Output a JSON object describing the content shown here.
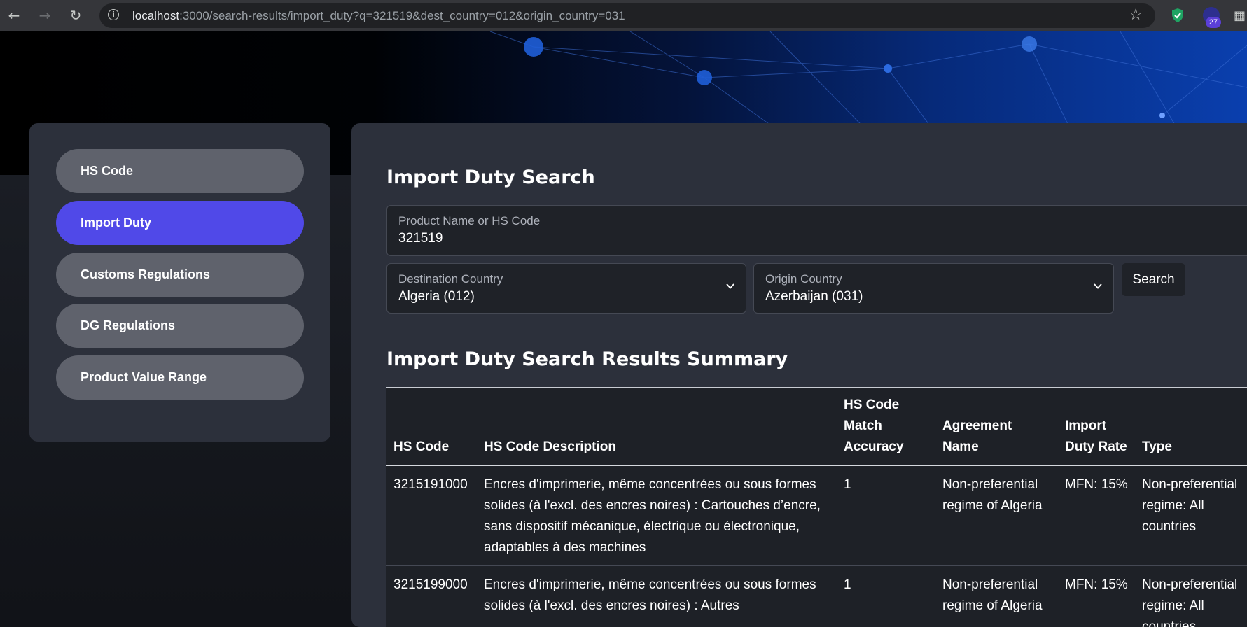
{
  "browser": {
    "url_host": "localhost",
    "url_rest": ":3000/search-results/import_duty?q=321519&dest_country=012&origin_country=031",
    "extension_badge": "27"
  },
  "sidebar": {
    "items": [
      {
        "label": "HS Code",
        "active": false
      },
      {
        "label": "Import Duty",
        "active": true
      },
      {
        "label": "Customs Regulations",
        "active": false
      },
      {
        "label": "DG Regulations",
        "active": false
      },
      {
        "label": "Product Value Range",
        "active": false
      }
    ]
  },
  "search": {
    "title": "Import Duty Search",
    "product_label": "Product Name or HS Code",
    "product_value": "321519",
    "dest_label": "Destination Country",
    "dest_value": "Algeria (012)",
    "origin_label": "Origin Country",
    "origin_value": "Azerbaijan (031)",
    "button_label": "Search"
  },
  "results": {
    "title": "Import Duty Search Results Summary",
    "columns": [
      "HS Code",
      "HS Code Description",
      "HS Code Match Accuracy",
      "Agreement Name",
      "Import Duty Rate",
      "Type"
    ],
    "rows": [
      {
        "hs_code": "3215191000",
        "description": "Encres d'imprimerie, même concentrées ou sous formes solides (à l'excl. des encres noires) : Cartouches d’encre, sans dispositif mécanique, électrique ou électronique, adaptables à des machines",
        "accuracy": "1",
        "agreement": "Non-preferential regime of Algeria",
        "rate": "MFN: 15%",
        "type": "Non-preferential regime: All countries"
      },
      {
        "hs_code": "3215199000",
        "description": "Encres d'imprimerie, même concentrées ou sous formes solides (à l'excl. des encres noires) : Autres",
        "accuracy": "1",
        "agreement": "Non-preferential regime of Algeria",
        "rate": "MFN: 15%",
        "type": "Non-preferential regime: All countries"
      }
    ]
  },
  "colors": {
    "accent": "#5049e8",
    "panel": "#2c303b",
    "sidebar_item": "#5f626c",
    "page_bg": "#111318"
  }
}
